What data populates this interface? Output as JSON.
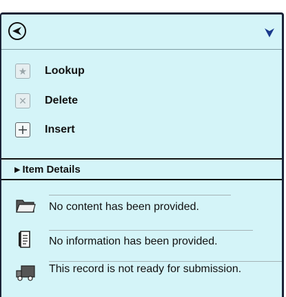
{
  "header": {
    "back_icon": "circle-back-arrow-icon",
    "menu_icon": "chevron-down-icon"
  },
  "actions": [
    {
      "label": "Lookup",
      "icon": "star-icon",
      "glyph": "★",
      "enabled": false
    },
    {
      "label": "Delete",
      "icon": "x-icon",
      "glyph": "✕",
      "enabled": false
    },
    {
      "label": "Insert",
      "icon": "plus-icon",
      "glyph": "+",
      "enabled": true
    }
  ],
  "section": {
    "title": "Item Details"
  },
  "info": [
    {
      "icon": "folder-icon",
      "text": "No content has been provided."
    },
    {
      "icon": "document-icon",
      "text": "No information has been provided."
    },
    {
      "icon": "truck-icon",
      "text": "This record is not ready for submission."
    }
  ],
  "colors": {
    "panel_bg": "#d4f4f8",
    "border": "#1a2236",
    "accent": "#1a3a8c"
  }
}
